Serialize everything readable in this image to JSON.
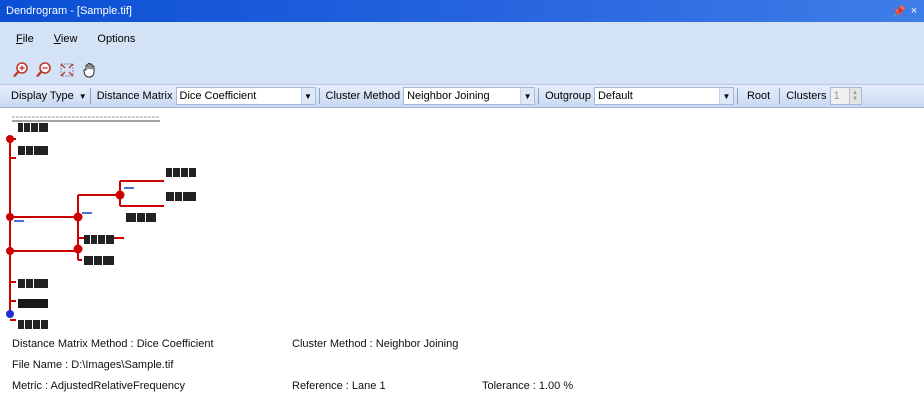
{
  "window": {
    "title": "Dendrogram - [Sample.tif]",
    "pin_glyph": " 4",
    "close_glyph": "×"
  },
  "menu": {
    "file": {
      "mnemonic": "F",
      "rest": "ile"
    },
    "view": {
      "mnemonic": "V",
      "rest": "iew"
    },
    "options": {
      "label": "Options"
    }
  },
  "toolbar_icons": [
    "zoom-in-icon",
    "zoom-out-icon",
    "fit-to-window-icon",
    "pan-hand-icon"
  ],
  "options_bar": {
    "display_type": "Display Type",
    "distance_matrix_label": "Distance Matrix",
    "distance_matrix_value": "Dice Coefficient",
    "cluster_method_label": "Cluster Method",
    "cluster_method_value": "Neighbor Joining",
    "outgroup_label": "Outgroup",
    "outgroup_value": "Default",
    "root_label": "Root",
    "clusters_label": "Clusters",
    "clusters_value": "1"
  },
  "dendrogram": {
    "line_color": "#cc0000",
    "root_node_color": "#1c2fd6",
    "leaf_count": 10
  },
  "info": {
    "distance_matrix_method": "Distance Matrix Method : Dice Coefficient",
    "cluster_method": "Cluster Method : Neighbor Joining",
    "file_name": "File Name : D:\\Images\\Sample.tif",
    "metric": "Metric  :  AdjustedRelativeFrequency",
    "reference": "Reference : Lane 1",
    "tolerance": "Tolerance : 1.00 %"
  },
  "colors": {
    "title_bar": "#0a4fd4",
    "menu_bar": "#d4e2f6",
    "branch": "#cc0000",
    "root_node": "#1c2fd6"
  }
}
